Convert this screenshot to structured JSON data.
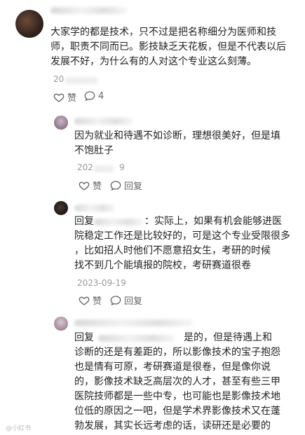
{
  "comment": {
    "body": "大家学的都是技术，只不过是把名称细分为医师和技\n师，职责不同而已。影技缺乏天花板，但是不代表以后\n发展不好，为什么有的人对这个专业这么刻薄。",
    "date": "20",
    "like_label": "赞",
    "reply_count": "4"
  },
  "replies": [
    {
      "body": "因为就业和待遇不如诊断，理想很美好，但是填\n不饱肚子",
      "date": "202",
      "date_suffix": "9",
      "like_label": "赞",
      "reply_label": "回复"
    },
    {
      "prefix": "回复",
      "body": "：实际上，如果有机会能够进医\n院稳定工作还是比较好的，可是这个专业受限很多\n，比如招人时他们不愿意招女生，考研的时候\n找不到几个能填报的院校，考研赛道很卷",
      "date": "2023-09-19",
      "like_label": "赞",
      "reply_label": "回复"
    },
    {
      "prefix": "回复",
      "body_first_line_end": "是的，但是待遇上和",
      "body": "诊断的还是有差距的，所以影像技术的宝子抱怨\n也是情有可原，考研赛道是很卷，但是像你说\n的，影像技术缺乏高层次的人才，甚至有些三甲\n医院技师都是一些中专，也可能也是影像技术地\n位低的原因之一吧，但是学术界影像技术又在蓬\n勃发展，其实长远考虑的话，读研还是必要的"
    }
  ],
  "watermark": "@小红书"
}
